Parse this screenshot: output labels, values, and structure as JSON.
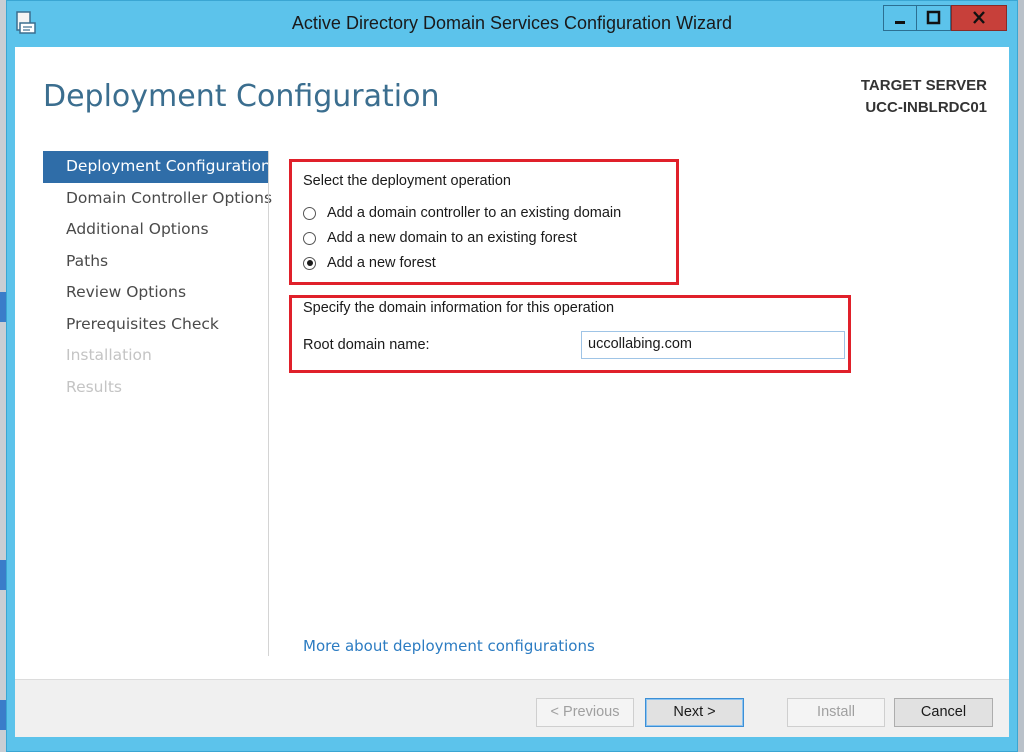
{
  "window": {
    "title": "Active Directory Domain Services Configuration Wizard"
  },
  "header": {
    "page_title": "Deployment Configuration",
    "target_server_label": "TARGET SERVER",
    "target_server_name": "UCC-INBLRDC01"
  },
  "sidebar": {
    "items": [
      {
        "label": "Deployment Configuration",
        "state": "active"
      },
      {
        "label": "Domain Controller Options",
        "state": "enabled"
      },
      {
        "label": "Additional Options",
        "state": "enabled"
      },
      {
        "label": "Paths",
        "state": "enabled"
      },
      {
        "label": "Review Options",
        "state": "enabled"
      },
      {
        "label": "Prerequisites Check",
        "state": "enabled"
      },
      {
        "label": "Installation",
        "state": "disabled"
      },
      {
        "label": "Results",
        "state": "disabled"
      }
    ]
  },
  "deployment": {
    "section_label": "Select the deployment operation",
    "options": [
      {
        "label": "Add a domain controller to an existing domain",
        "checked": false
      },
      {
        "label": "Add a new domain to an existing forest",
        "checked": false
      },
      {
        "label": "Add a new forest",
        "checked": true
      }
    ]
  },
  "domain_info": {
    "section_label": "Specify the domain information for this operation",
    "root_domain_label": "Root domain name:",
    "root_domain_value": "uccollabing.com"
  },
  "links": {
    "more": "More about deployment configurations"
  },
  "buttons": {
    "previous": "< Previous",
    "next": "Next >",
    "install": "Install",
    "cancel": "Cancel"
  },
  "colors": {
    "titlebar": "#5cc3eb",
    "close_button": "#c7403a",
    "nav_active": "#2f6da8",
    "highlight_box": "#e0202a",
    "link": "#2c7cc2"
  },
  "icons": {
    "app": "ad-wizard-icon",
    "minimize": "minimize-icon",
    "maximize": "maximize-icon",
    "close": "close-icon"
  }
}
